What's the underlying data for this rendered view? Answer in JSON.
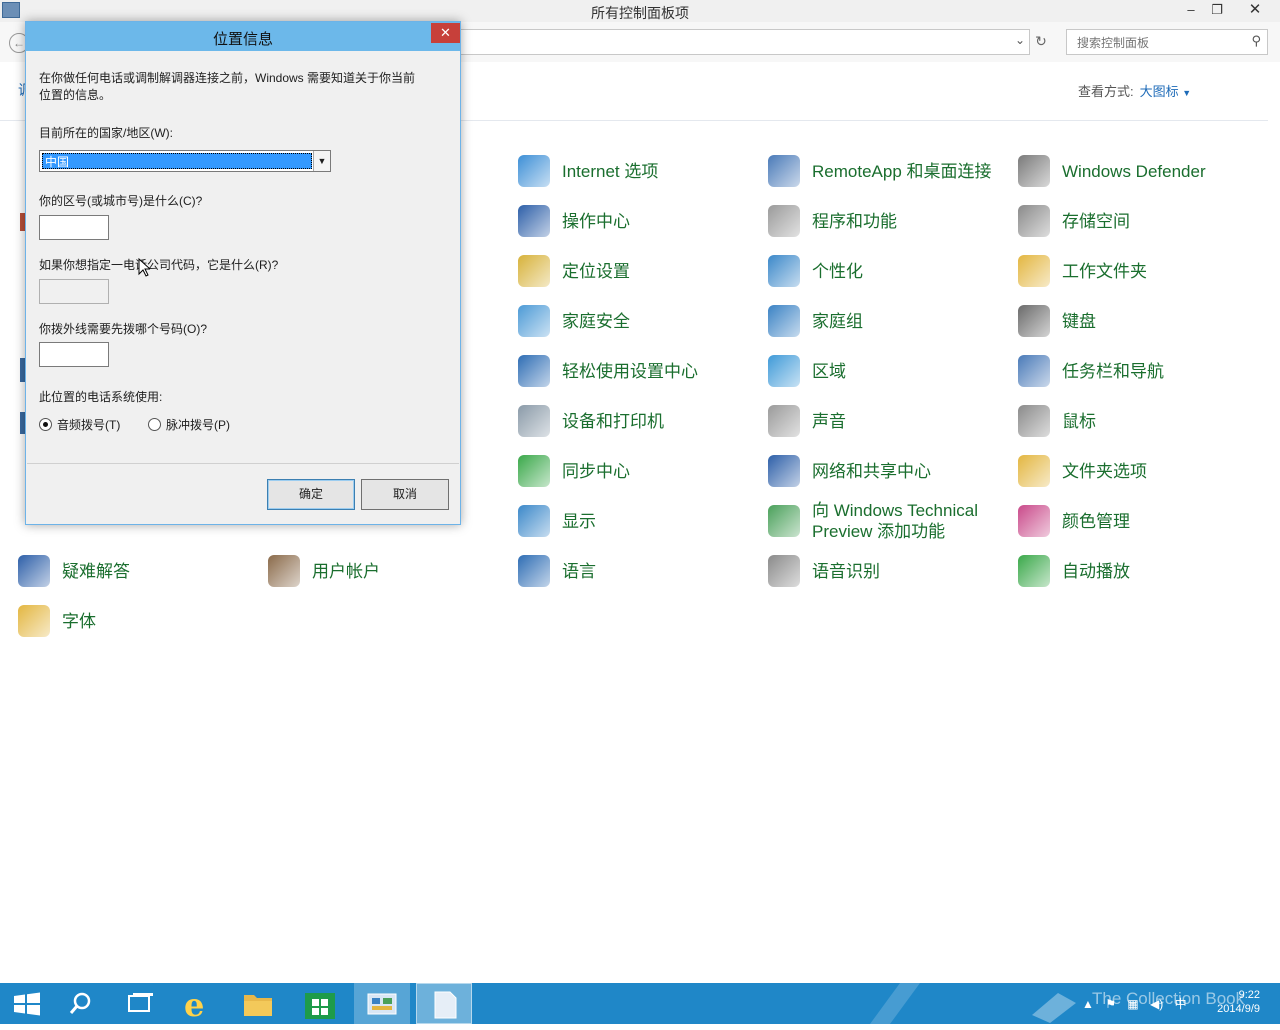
{
  "window": {
    "title": "所有控制面板项"
  },
  "address": {
    "search_placeholder": "搜索控制面板"
  },
  "view": {
    "label": "查看方式:",
    "value": "大图标"
  },
  "partial_left_text": "调",
  "items": [
    {
      "label": "Internet 选项",
      "icon": "internet-options-icon",
      "color": "#3d8fd6"
    },
    {
      "label": "RemoteApp 和桌面连接",
      "icon": "remoteapp-icon",
      "color": "#4a7ab8"
    },
    {
      "label": "Windows Defender",
      "icon": "windows-defender-icon",
      "color": "#7a7a7a"
    },
    {
      "label": "操作中心",
      "icon": "action-center-flag-icon",
      "color": "#2d5fa8"
    },
    {
      "label": "程序和功能",
      "icon": "programs-features-icon",
      "color": "#9a9a9a"
    },
    {
      "label": "存储空间",
      "icon": "storage-spaces-icon",
      "color": "#8a8a8a"
    },
    {
      "label": "定位设置",
      "icon": "location-settings-icon",
      "color": "#d7b23a"
    },
    {
      "label": "个性化",
      "icon": "personalization-icon",
      "color": "#3b88c9"
    },
    {
      "label": "工作文件夹",
      "icon": "work-folders-icon",
      "color": "#e3b640"
    },
    {
      "label": "家庭安全",
      "icon": "family-safety-icon",
      "color": "#4c9ad6"
    },
    {
      "label": "家庭组",
      "icon": "homegroup-icon",
      "color": "#3a82c4"
    },
    {
      "label": "键盘",
      "icon": "keyboard-icon",
      "color": "#6a6a6a"
    },
    {
      "label": "轻松使用设置中心",
      "icon": "ease-of-access-icon",
      "color": "#2e6db4"
    },
    {
      "label": "区域",
      "icon": "region-icon",
      "color": "#3f9ad8"
    },
    {
      "label": "任务栏和导航",
      "icon": "taskbar-navigation-icon",
      "color": "#4a7ab8"
    },
    {
      "label": "设备和打印机",
      "icon": "devices-printers-icon",
      "color": "#8a9aa8"
    },
    {
      "label": "声音",
      "icon": "sound-icon",
      "color": "#9a9a9a"
    },
    {
      "label": "鼠标",
      "icon": "mouse-icon",
      "color": "#8a8a8a"
    },
    {
      "label": "同步中心",
      "icon": "sync-center-icon",
      "color": "#3aa84a"
    },
    {
      "label": "网络和共享中心",
      "icon": "network-sharing-icon",
      "color": "#2d5fa8"
    },
    {
      "label": "文件夹选项",
      "icon": "folder-options-icon",
      "color": "#e3b640"
    },
    {
      "label": "显示",
      "icon": "display-icon",
      "color": "#3b88c9"
    },
    {
      "label": "向 Windows Technical\nPreview 添加功能",
      "icon": "add-features-icon",
      "color": "#4aa05a"
    },
    {
      "label": "颜色管理",
      "icon": "color-management-icon",
      "color": "#c94a8a"
    },
    {
      "label": "疑难解答",
      "icon": "troubleshooting-icon",
      "color": "#2d5fa8"
    },
    {
      "label": "用户帐户",
      "icon": "user-accounts-icon",
      "color": "#8a6a4a"
    },
    {
      "label": "语言",
      "icon": "language-icon",
      "color": "#2e6db4"
    },
    {
      "label": "语音识别",
      "icon": "speech-recognition-icon",
      "color": "#8a8a8a"
    },
    {
      "label": "自动播放",
      "icon": "autoplay-icon",
      "color": "#3aa84a"
    },
    {
      "label": "字体",
      "icon": "fonts-icon",
      "color": "#e3b640"
    }
  ],
  "dialog": {
    "title": "位置信息",
    "intro": "在你做任何电话或调制解调器连接之前，Windows 需要知道关于你当前",
    "intro2": "位置的信息。",
    "country_label": "目前所在的国家/地区(W):",
    "country_value": "中国",
    "area_label": "你的区号(或城市号)是什么(C)?",
    "carrier_label": "如果你想指定一电话公司代码，它是什么(R)?",
    "outside_label": "你拨外线需要先拨哪个号码(O)?",
    "phone_system_label": "此位置的电话系统使用:",
    "tone_label": "音频拨号(T)",
    "pulse_label": "脉冲拨号(P)",
    "tone_selected": true,
    "ok_label": "确定",
    "cancel_label": "取消"
  },
  "taskbar": {
    "time": "9:22",
    "date": "2014/9/9",
    "watermark": "The Collection Book",
    "ime": "中"
  }
}
